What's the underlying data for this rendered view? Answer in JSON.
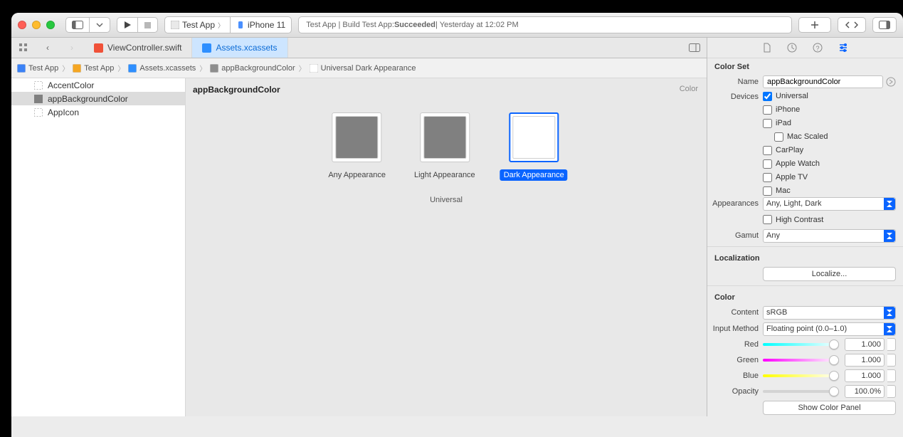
{
  "toolbar": {
    "scheme_app": "Test App",
    "scheme_device": "iPhone 11",
    "status_prefix": "Test App | Build Test App: ",
    "status_bold": "Succeeded",
    "status_suffix": " | Yesterday at 12:02 PM"
  },
  "tabs": [
    {
      "label": "ViewController.swift",
      "active": false,
      "icon": "swift"
    },
    {
      "label": "Assets.xcassets",
      "active": true,
      "icon": "xcassets"
    }
  ],
  "breadcrumb": [
    {
      "label": "Test App",
      "icon": "project"
    },
    {
      "label": "Test App",
      "icon": "folder"
    },
    {
      "label": "Assets.xcassets",
      "icon": "xcassets"
    },
    {
      "label": "appBackgroundColor",
      "icon": "colorset"
    },
    {
      "label": "Universal Dark Appearance",
      "icon": "color-white"
    }
  ],
  "assets": [
    {
      "name": "AccentColor",
      "selected": false,
      "swatch_kind": "empty"
    },
    {
      "name": "appBackgroundColor",
      "selected": true,
      "swatch_kind": "gray"
    },
    {
      "name": "AppIcon",
      "selected": false,
      "swatch_kind": "empty"
    }
  ],
  "editor": {
    "title": "appBackgroundColor",
    "corner": "Color",
    "group": "Universal",
    "wells": [
      {
        "label": "Any Appearance",
        "color": "#808080",
        "selected": false
      },
      {
        "label": "Light Appearance",
        "color": "#808080",
        "selected": false
      },
      {
        "label": "Dark Appearance",
        "color": "#ffffff",
        "selected": true
      }
    ]
  },
  "inspector": {
    "colorset_header": "Color Set",
    "name_label": "Name",
    "name_value": "appBackgroundColor",
    "devices_label": "Devices",
    "devices": [
      {
        "label": "Universal",
        "checked": true,
        "indent": 0
      },
      {
        "label": "iPhone",
        "checked": false,
        "indent": 0
      },
      {
        "label": "iPad",
        "checked": false,
        "indent": 0
      },
      {
        "label": "Mac Scaled",
        "checked": false,
        "indent": 1
      },
      {
        "label": "CarPlay",
        "checked": false,
        "indent": 0
      },
      {
        "label": "Apple Watch",
        "checked": false,
        "indent": 0
      },
      {
        "label": "Apple TV",
        "checked": false,
        "indent": 0
      },
      {
        "label": "Mac",
        "checked": false,
        "indent": 0
      }
    ],
    "appearances_label": "Appearances",
    "appearances_value": "Any, Light, Dark",
    "high_contrast_label": "High Contrast",
    "gamut_label": "Gamut",
    "gamut_value": "Any",
    "localization_header": "Localization",
    "localize_button": "Localize...",
    "color_header": "Color",
    "content_label": "Content",
    "content_value": "sRGB",
    "input_method_label": "Input Method",
    "input_method_value": "Floating point (0.0–1.0)",
    "channels": [
      {
        "label": "Red",
        "value": "1.000",
        "gradient": "linear-gradient(to right,#00ffff,#ffffff)"
      },
      {
        "label": "Green",
        "value": "1.000",
        "gradient": "linear-gradient(to right,#ff00ff,#ffffff)"
      },
      {
        "label": "Blue",
        "value": "1.000",
        "gradient": "linear-gradient(to right,#ffff00,#ffffff)"
      }
    ],
    "opacity_label": "Opacity",
    "opacity_value": "100.0%",
    "show_panel": "Show Color Panel"
  }
}
